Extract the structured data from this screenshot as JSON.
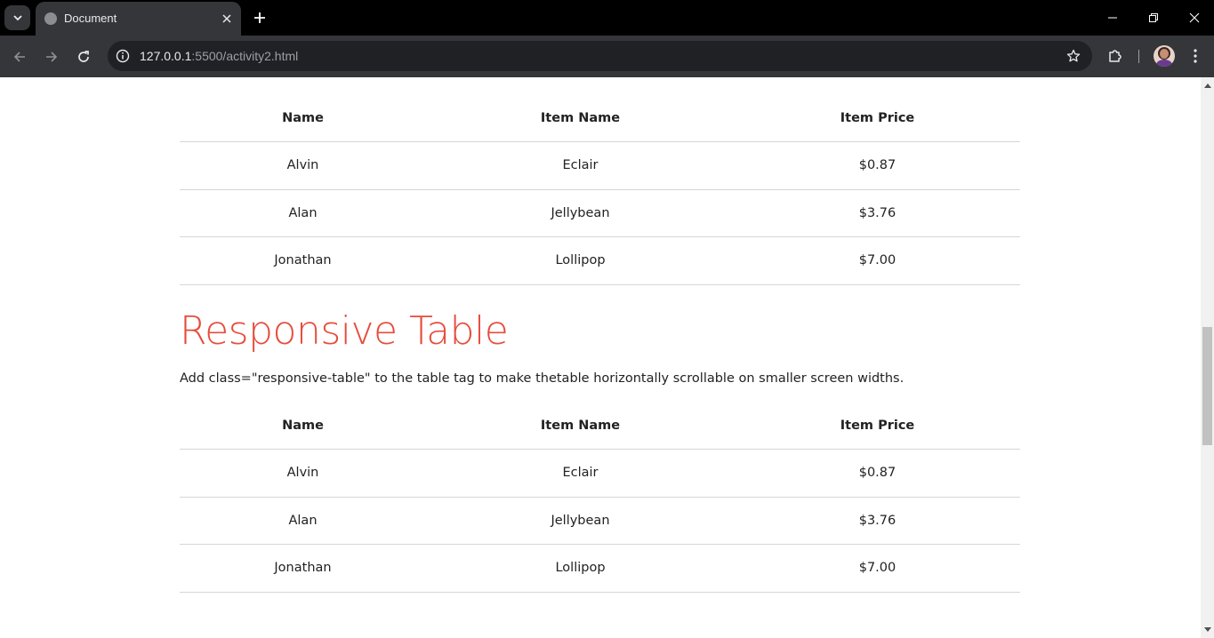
{
  "browser": {
    "tab_title": "Document",
    "url_host": "127.0.0.1",
    "url_path": ":5500/activity2.html"
  },
  "page": {
    "section_heading": "Responsive Table",
    "section_description": "Add class=\"responsive-table\" to the table tag to make thetable horizontally scrollable on smaller screen widths.",
    "table1": {
      "headers": [
        "Name",
        "Item Name",
        "Item Price"
      ],
      "rows": [
        [
          "Alvin",
          "Eclair",
          "$0.87"
        ],
        [
          "Alan",
          "Jellybean",
          "$3.76"
        ],
        [
          "Jonathan",
          "Lollipop",
          "$7.00"
        ]
      ]
    },
    "table2": {
      "headers": [
        "Name",
        "Item Name",
        "Item Price"
      ],
      "rows": [
        [
          "Alvin",
          "Eclair",
          "$0.87"
        ],
        [
          "Alan",
          "Jellybean",
          "$3.76"
        ],
        [
          "Jonathan",
          "Lollipop",
          "$7.00"
        ]
      ]
    }
  },
  "colors": {
    "heading_accent": "#e74c3c",
    "chrome_dark": "#35363a",
    "omnibox": "#202124"
  }
}
